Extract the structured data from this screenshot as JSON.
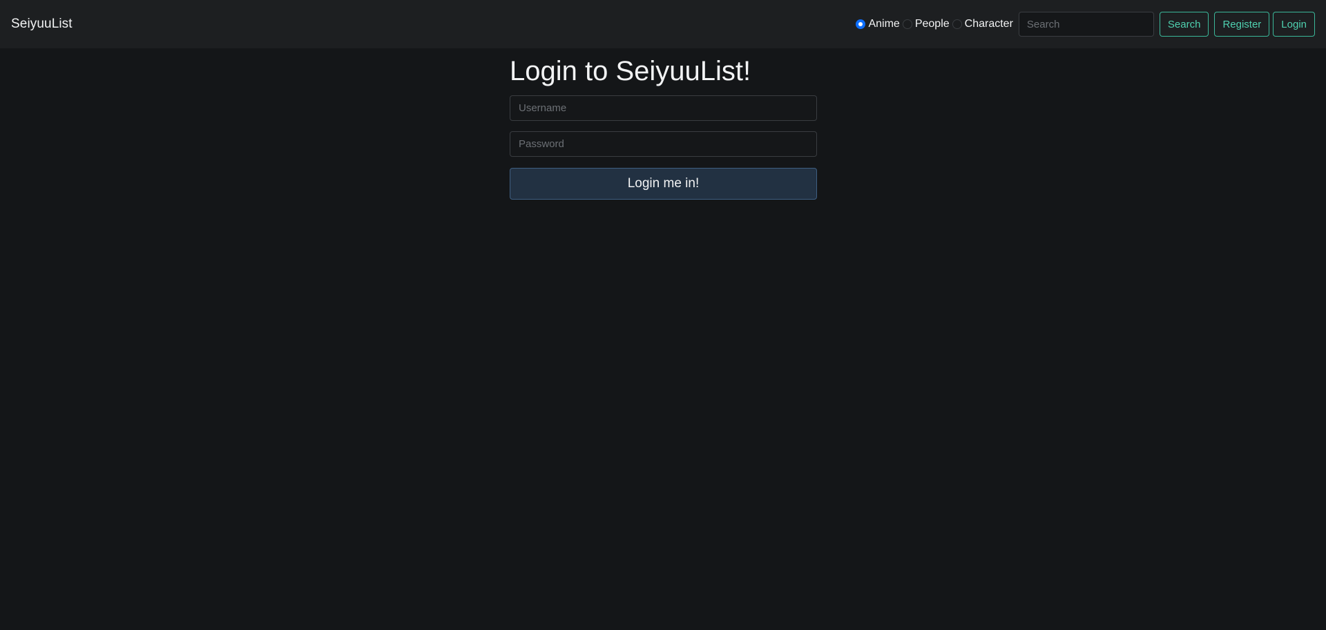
{
  "navbar": {
    "brand": "SeiyuuList",
    "search_types": [
      {
        "label": "Anime",
        "checked": true
      },
      {
        "label": "People",
        "checked": false
      },
      {
        "label": "Character",
        "checked": false
      }
    ],
    "search_placeholder": "Search",
    "search_button": "Search",
    "register_button": "Register",
    "login_button": "Login"
  },
  "login_form": {
    "title": "Login to SeiyuuList!",
    "username_placeholder": "Username",
    "password_placeholder": "Password",
    "submit_label": "Login me in!"
  },
  "colors": {
    "background": "#141618",
    "navbar_background": "#1d1f21",
    "accent_outline": "#3bb89a",
    "radio_checked": "#0d6efd",
    "submit_background": "#223142"
  }
}
